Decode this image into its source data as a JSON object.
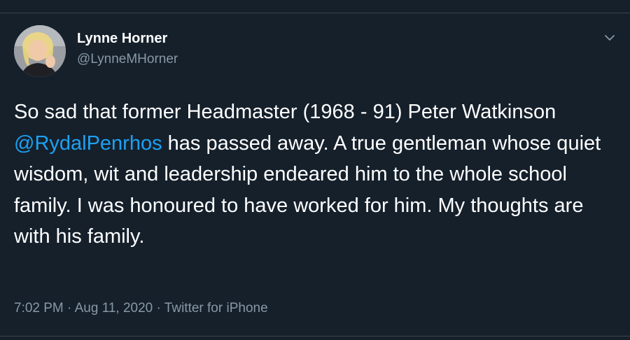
{
  "tweet": {
    "author": {
      "name": "Lynne Horner",
      "handle": "@LynneMHorner",
      "avatar_icon": "profile-photo"
    },
    "text_before_mention": "So sad that former Headmaster (1968 - 91) Peter Watkinson ",
    "mention": "@RydalPenrhos",
    "text_after_mention": " has passed away. A true gentleman whose quiet wisdom, wit and leadership endeared him to the whole school family. I was honoured to have worked for him. My thoughts are with his family.",
    "time": "7:02 PM",
    "date": "Aug 11, 2020",
    "source": "Twitter for iPhone",
    "separator": "·",
    "menu_icon": "chevron-down-icon"
  },
  "colors": {
    "background": "#15202b",
    "text": "#ffffff",
    "secondary_text": "#8899a6",
    "link": "#1da1f2",
    "divider": "#38444d"
  }
}
